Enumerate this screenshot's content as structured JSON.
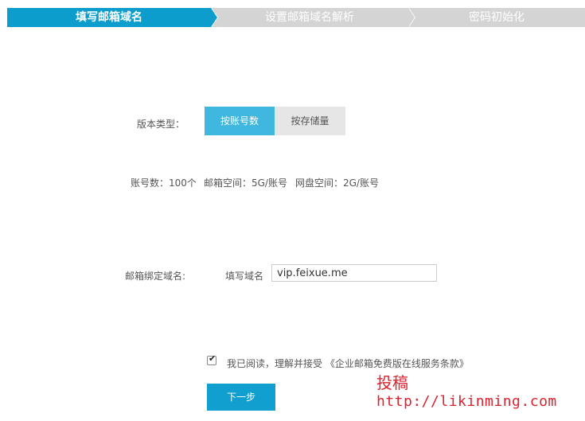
{
  "steps": [
    {
      "label": "填写邮箱域名",
      "active": true
    },
    {
      "label": "设置邮箱域名解析",
      "active": false
    },
    {
      "label": "密码初始化",
      "active": false
    }
  ],
  "version": {
    "label": "版本类型：",
    "options": [
      "按账号数",
      "按存储量"
    ],
    "selected": "按账号数"
  },
  "info": {
    "accounts": "账号数：100个",
    "mailbox_space": "邮箱空间：5G/账号",
    "disk_space": "网盘空间：2G/账号"
  },
  "domain": {
    "label": "邮箱绑定域名:",
    "field_label": "填写域名",
    "value": "vip.feixue.me"
  },
  "agreement": {
    "checked": true,
    "text": "我已阅读，理解并接受",
    "link": "《企业邮箱免费版在线服务条款》"
  },
  "next_button": "下一步",
  "watermark": {
    "line1": "投稿",
    "line2": "http://likinming.com"
  },
  "colors": {
    "active_step": "#0d9dcc",
    "inactive_step": "#d4d4d4",
    "primary_button": "#119fcf",
    "selected_option": "#3fb7de",
    "watermark": "#d9232f"
  }
}
